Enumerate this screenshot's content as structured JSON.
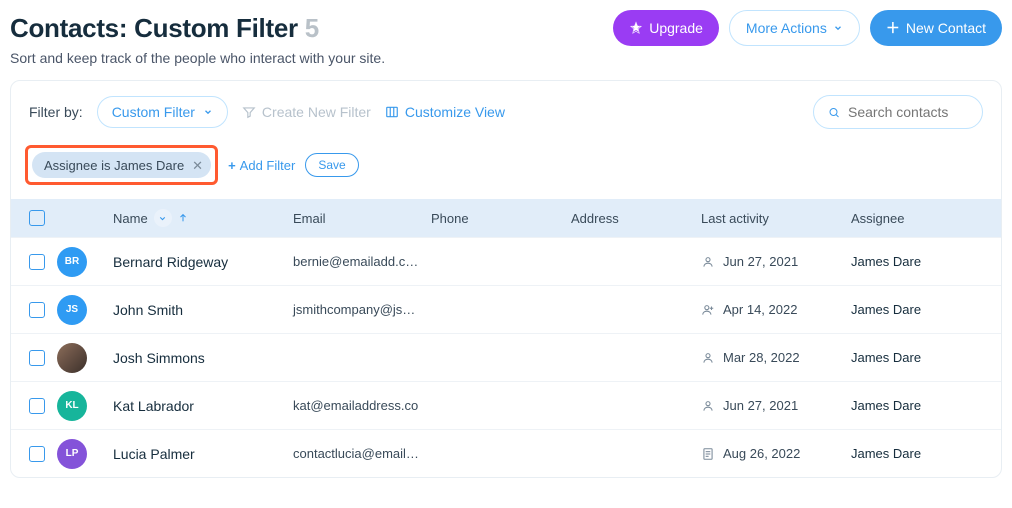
{
  "header": {
    "title_prefix": "Contacts:",
    "title_filter": "Custom Filter",
    "count": "5",
    "subtitle": "Sort and keep track of the people who interact with your site.",
    "upgrade": "Upgrade",
    "more_actions": "More Actions",
    "new_contact": "New Contact"
  },
  "toolbar": {
    "filter_by_label": "Filter by:",
    "filter_dropdown": "Custom Filter",
    "create_new_filter": "Create New Filter",
    "customize_view": "Customize View",
    "search_placeholder": "Search contacts"
  },
  "filters": {
    "chip_label": "Assignee is James Dare",
    "add_filter": "Add Filter",
    "save": "Save"
  },
  "columns": {
    "name": "Name",
    "email": "Email",
    "phone": "Phone",
    "address": "Address",
    "last_activity": "Last activity",
    "assignee": "Assignee"
  },
  "rows": [
    {
      "initials": "BR",
      "avatar_color": "#2f9bf3",
      "avatar_type": "initials",
      "name": "Bernard Ridgeway",
      "email": "bernie@emailadd.c…",
      "phone": "",
      "address": "",
      "activity_icon": "person",
      "activity": "Jun 27, 2021",
      "assignee": "James Dare"
    },
    {
      "initials": "JS",
      "avatar_color": "#2f9bf3",
      "avatar_type": "initials",
      "name": "John Smith",
      "email": "jsmithcompany@js…",
      "phone": "",
      "address": "",
      "activity_icon": "person-plus",
      "activity": "Apr 14, 2022",
      "assignee": "James Dare"
    },
    {
      "initials": "",
      "avatar_color": "",
      "avatar_type": "photo",
      "name": "Josh Simmons",
      "email": "",
      "phone": "",
      "address": "",
      "activity_icon": "person",
      "activity": "Mar 28, 2022",
      "assignee": "James Dare"
    },
    {
      "initials": "KL",
      "avatar_color": "#17b59b",
      "avatar_type": "initials",
      "name": "Kat Labrador",
      "email": "kat@emailaddress.co",
      "phone": "",
      "address": "",
      "activity_icon": "person",
      "activity": "Jun 27, 2021",
      "assignee": "James Dare"
    },
    {
      "initials": "LP",
      "avatar_color": "#8453d9",
      "avatar_type": "initials",
      "name": "Lucia Palmer",
      "email": "contactlucia@email…",
      "phone": "",
      "address": "",
      "activity_icon": "form",
      "activity": "Aug 26, 2022",
      "assignee": "James Dare"
    }
  ]
}
